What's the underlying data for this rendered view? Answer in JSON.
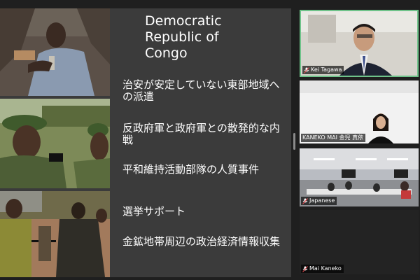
{
  "slide": {
    "title": "Democratic\nRepublic of\nCongo",
    "bullets": [
      "治安が安定していない東部地域への派遣",
      "反政府軍と政府軍との散発的な内戦",
      "平和維持活動部隊の人質事件",
      "選挙サポート",
      "金鉱地帯周辺の政治経済情報収集"
    ]
  },
  "participants": [
    {
      "name": "Kei Tagawa",
      "icon": "mic-muted-icon",
      "active_speaker": true
    },
    {
      "name": "KANEKO MAI 金児 真依",
      "icon": "none"
    },
    {
      "name": "Japanese",
      "icon": "mic-muted-icon"
    },
    {
      "name": "Mai Kaneko",
      "icon": "mic-muted-icon"
    }
  ],
  "colors": {
    "active_speaker_border": "#6fc38a",
    "slide_bg": "#3b3b3b",
    "app_bg": "#1f1f1f"
  }
}
